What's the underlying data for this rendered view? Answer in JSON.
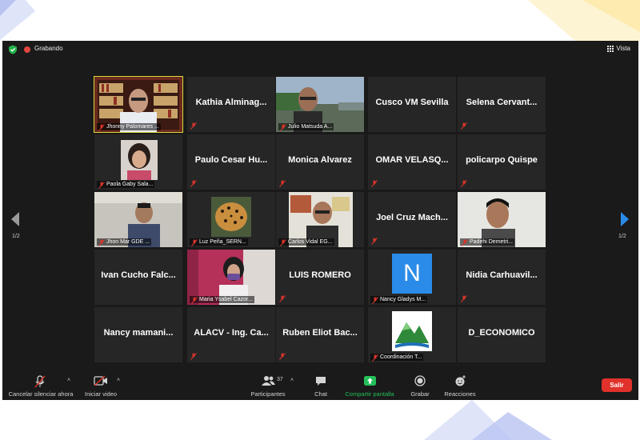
{
  "topbar": {
    "recording_label": "Grabando",
    "view_label": "Vista"
  },
  "tiles": [
    {
      "name": "",
      "label": "Jhonny Palomares ..."
    },
    {
      "name": "Kathia  Alminag...",
      "label": ""
    },
    {
      "name": "",
      "label": "Julio Matsuda A..."
    },
    {
      "name": "Cusco VM Sevilla",
      "label": ""
    },
    {
      "name": "Selena  Cervant...",
      "label": ""
    },
    {
      "name": "",
      "label": "Paola Gaby Sala..."
    },
    {
      "name": "Paulo Cesar Hu...",
      "label": ""
    },
    {
      "name": "Monica Alvarez",
      "label": ""
    },
    {
      "name": "OMAR  VELASQ...",
      "label": ""
    },
    {
      "name": "policarpo Quispe",
      "label": ""
    },
    {
      "name": "",
      "label": "Jhon Mar GDE ..."
    },
    {
      "name": "",
      "label": "Luz Peña_SERN..."
    },
    {
      "name": "",
      "label": "Carlos Vidal EG..."
    },
    {
      "name": "Joel Cruz Mach...",
      "label": ""
    },
    {
      "name": "",
      "label": "Padehi Demetri..."
    },
    {
      "name": "Ivan  Cucho  Falc...",
      "label": ""
    },
    {
      "name": "",
      "label": "Maria Ysabel Cazor..."
    },
    {
      "name": "LUIS ROMERO",
      "label": ""
    },
    {
      "name": "",
      "label": "Nancy Gladys M...",
      "avatar_letter": "N"
    },
    {
      "name": "Nidia  Carhuavil...",
      "label": ""
    },
    {
      "name": "Nancy  mamani...",
      "label": ""
    },
    {
      "name": "ALACV - Ing. Ca...",
      "label": ""
    },
    {
      "name": "Ruben Eliot Bac...",
      "label": ""
    },
    {
      "name": "",
      "label": "Coordinación T..."
    },
    {
      "name": "D_ECONOMICO",
      "label": ""
    }
  ],
  "pagination": {
    "left": "1/2",
    "right": "1/2"
  },
  "toolbar": {
    "unmute": "Cancelar silenciar ahora",
    "video": "Iniciar video",
    "participants": "Participantes",
    "participants_count": "37",
    "chat": "Chat",
    "share": "Compartir pantalla",
    "record": "Grabar",
    "reactions": "Reacciones",
    "leave": "Salir"
  },
  "colors": {
    "active_speaker": "#d8d93a",
    "share_green": "#24c05a",
    "leave_red": "#e0312b",
    "muted_red": "#d9352b",
    "accent_blue": "#2b8be8"
  },
  "icons": [
    "shield-check-icon",
    "grid-icon",
    "muted-mic-icon",
    "video-off-icon",
    "participants-icon",
    "chat-icon",
    "share-screen-icon",
    "record-icon",
    "reactions-icon",
    "chevron-left-icon",
    "chevron-right-icon"
  ]
}
